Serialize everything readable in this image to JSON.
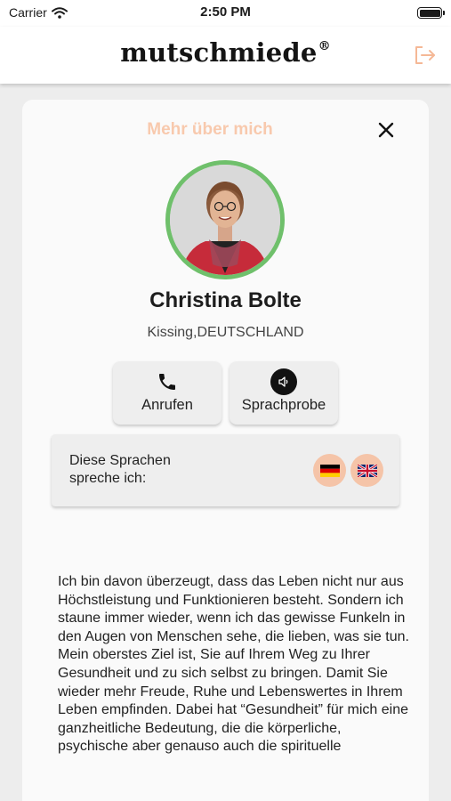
{
  "status_bar": {
    "carrier": "Carrier",
    "time": "2:50 PM"
  },
  "header": {
    "logo_text": "mutschmiede",
    "logo_mark": "®",
    "logout_icon": "logout-icon"
  },
  "card": {
    "title": "Mehr über mich",
    "name": "Christina Bolte",
    "location": "Kissing,DEUTSCHLAND",
    "buttons": {
      "call": "Anrufen",
      "sample": "Sprachprobe"
    },
    "languages": {
      "label": "Diese Sprachen spreche ich:",
      "flags": [
        "german-flag-icon",
        "uk-flag-icon"
      ]
    },
    "bio": "Ich bin davon überzeugt, dass das Leben nicht nur aus Höchstleistung und Funktionieren besteht. Sondern ich staune immer wieder, wenn ich das gewisse Funkeln in den Augen von Menschen sehe, die lieben, was sie tun. Mein oberstes Ziel ist, Sie auf Ihrem Weg zu Ihrer Gesundheit und zu sich selbst zu bringen. Damit Sie wieder mehr Freude, Ruhe und Lebenswertes in Ihrem Leben empfinden. Dabei hat “Gesundheit” für mich eine ganzheitliche Bedeutung, die die körperliche, psychische aber genauso auch die spirituelle"
  },
  "colors": {
    "title": "#f8c9ad",
    "avatar_ring": "#6fc06b",
    "flag_bubble": "#f5c4a8",
    "logout": "#f5b896"
  }
}
